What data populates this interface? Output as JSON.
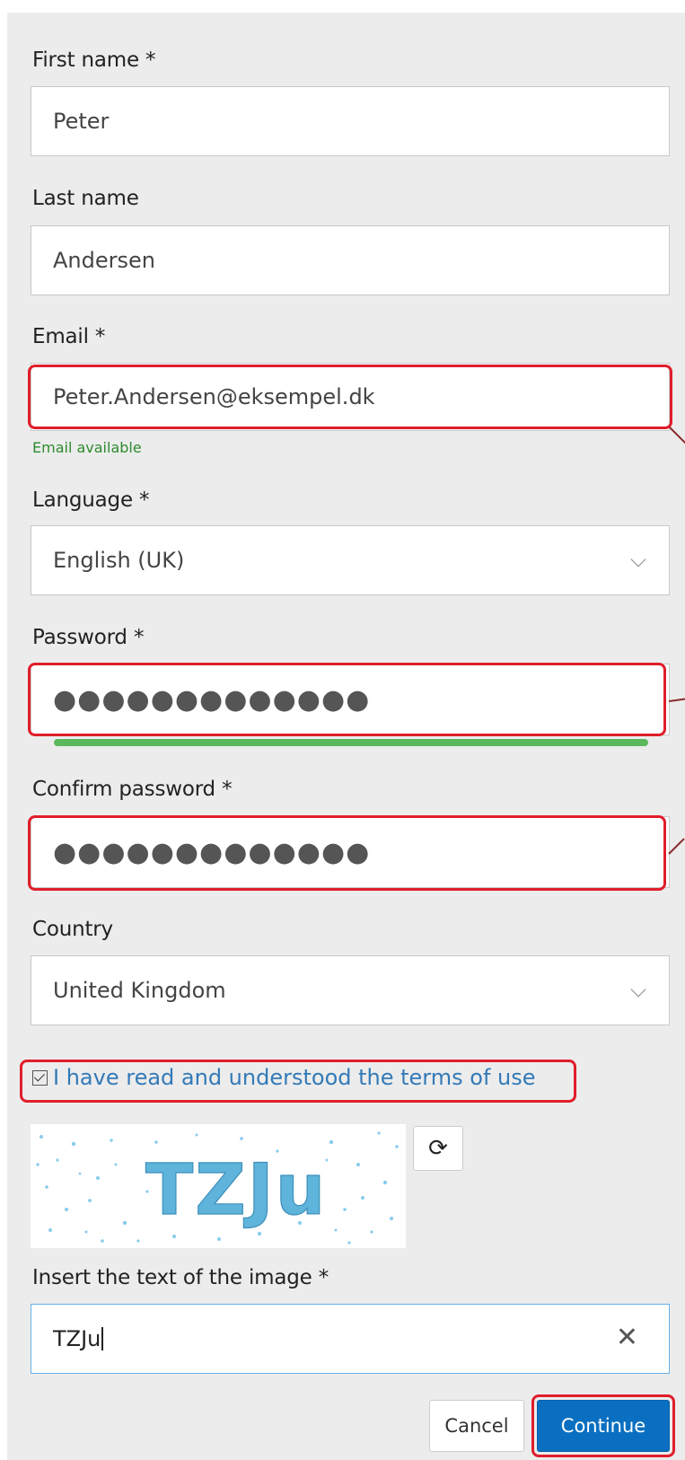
{
  "form": {
    "first_name": {
      "label": "First name *",
      "value": "Peter"
    },
    "last_name": {
      "label": "Last name",
      "value": "Andersen"
    },
    "email": {
      "label": "Email *",
      "value": "Peter.Andersen@eksempel.dk",
      "status": "Email available"
    },
    "language": {
      "label": "Language *",
      "value": "English (UK)"
    },
    "password": {
      "label": "Password *",
      "value": "●●●●●●●●●●●●●"
    },
    "confirm_password": {
      "label": "Confirm password *",
      "value": "●●●●●●●●●●●●●"
    },
    "country": {
      "label": "Country",
      "value": "United Kingdom"
    },
    "terms": {
      "label": "I have read and understood the terms of use",
      "checked": true
    },
    "captcha": {
      "image_text": "TZJu",
      "refresh_icon": "refresh-icon"
    },
    "captcha_input": {
      "label": "Insert the text of the image *",
      "value": "TZJu",
      "clear_icon": "clear-icon"
    }
  },
  "buttons": {
    "cancel": "Cancel",
    "continue": "Continue"
  },
  "colors": {
    "highlight": "#e01e2b",
    "success": "#2e8b2e",
    "link": "#337ab7",
    "primary": "#0a6fc0",
    "strength_bar": "#5cb85c"
  }
}
